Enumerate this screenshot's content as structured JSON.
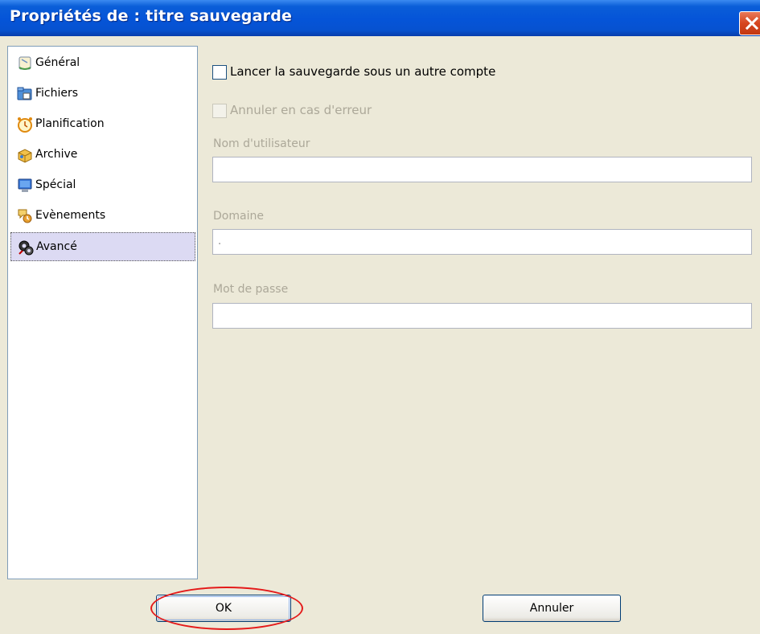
{
  "window": {
    "title": "Propriétés de : titre sauvegarde"
  },
  "sidebar": {
    "items": [
      {
        "label": "Général",
        "icon": "general-icon"
      },
      {
        "label": "Fichiers",
        "icon": "files-icon"
      },
      {
        "label": "Planification",
        "icon": "clock-icon"
      },
      {
        "label": "Archive",
        "icon": "archive-icon"
      },
      {
        "label": "Spécial",
        "icon": "monitor-icon"
      },
      {
        "label": "Evènements",
        "icon": "events-icon"
      },
      {
        "label": "Avancé",
        "icon": "advanced-icon",
        "selected": true
      }
    ]
  },
  "content": {
    "run_as_other_account": {
      "label": "Lancer la sauvegarde sous un autre compte",
      "checked": false
    },
    "cancel_on_error": {
      "label": "Annuler en cas d'erreur",
      "checked": false,
      "disabled": true
    },
    "username": {
      "label": "Nom d'utilisateur",
      "value": ""
    },
    "domain": {
      "label": "Domaine",
      "value": "."
    },
    "password": {
      "label": "Mot de passe",
      "value": ""
    }
  },
  "footer": {
    "ok_label": "OK",
    "cancel_label": "Annuler"
  }
}
